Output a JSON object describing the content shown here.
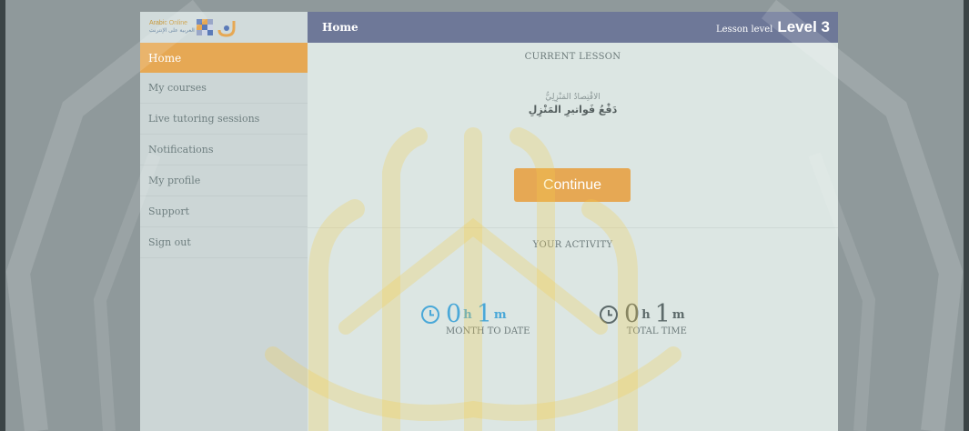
{
  "sidebar": {
    "logo_en": "Arabic Online",
    "logo_ar": "العربية على الإنترنت",
    "items": [
      {
        "label": "Home",
        "active": true
      },
      {
        "label": "My courses"
      },
      {
        "label": "Live tutoring sessions"
      },
      {
        "label": "Notifications"
      },
      {
        "label": "My profile"
      },
      {
        "label": "Support"
      },
      {
        "label": "Sign out"
      }
    ]
  },
  "header": {
    "title": "Home",
    "level_label": "Lesson level",
    "level_value": "Level 3"
  },
  "current_lesson": {
    "heading": "CURRENT LESSON",
    "subtitle_ar": "الاقْتِصادُ المَنْزِلِيُّ",
    "title_ar": "دَفْعُ فَواتيرِ المَنْزِلِ",
    "continue_label": "Continue"
  },
  "activity": {
    "heading": "YOUR ACTIVITY",
    "stats": [
      {
        "hours": "0",
        "hours_unit": "h",
        "minutes": "1",
        "minutes_unit": "m",
        "label": "MONTH TO DATE"
      },
      {
        "hours": "0",
        "hours_unit": "h",
        "minutes": "1",
        "minutes_unit": "m",
        "label": "TOTAL TIME"
      }
    ]
  },
  "colors": {
    "accent": "#e6a854",
    "topbar": "#6e7898",
    "stat_blue": "#4aa8d8",
    "stat_gray": "#5d6a6a"
  },
  "icons": [
    "logo-grid-icon",
    "logo-mark-icon",
    "clock-icon",
    "watermark-seal"
  ]
}
